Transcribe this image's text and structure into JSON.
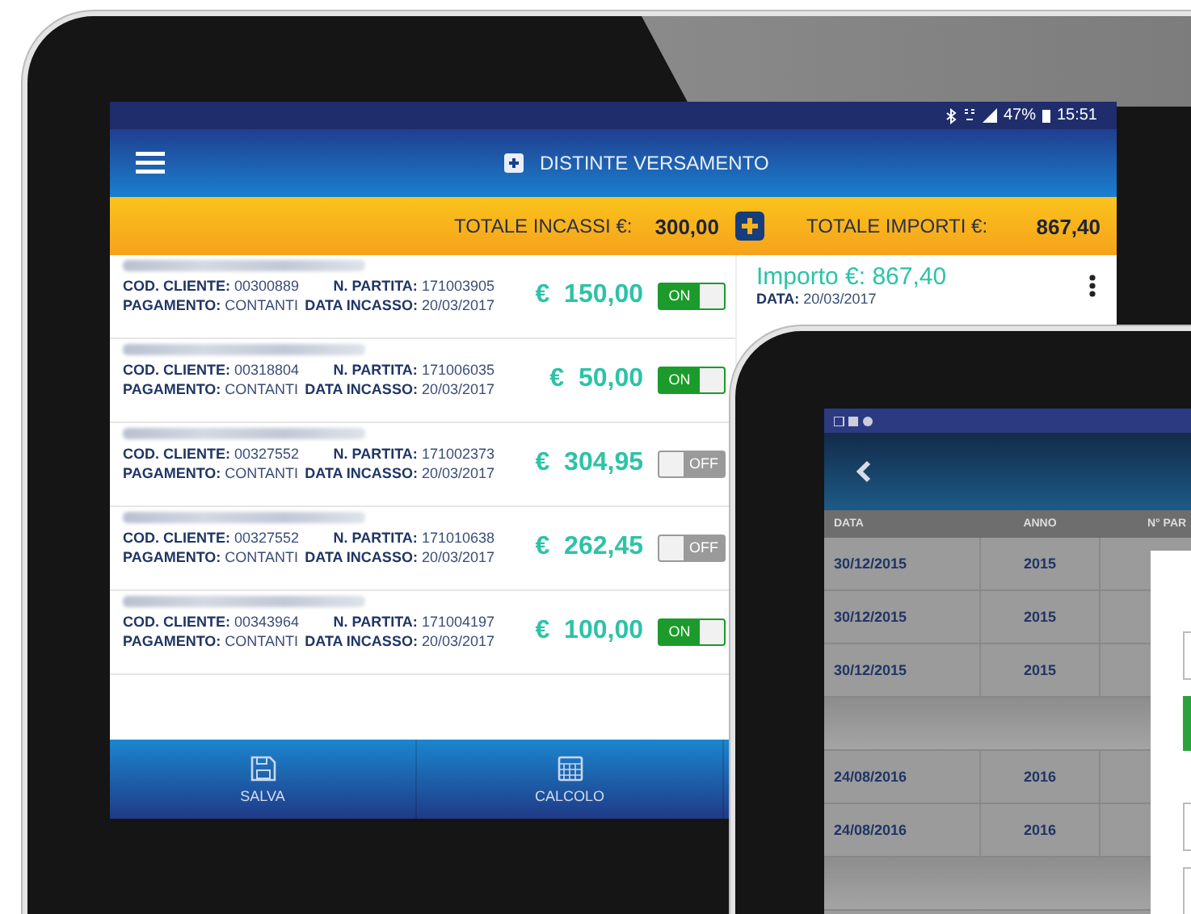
{
  "tablet_main": {
    "status_bar": {
      "battery": "47%",
      "time": "15:51"
    },
    "header": {
      "title": "DISTINTE VERSAMENTO"
    },
    "totals": {
      "incassi_label": "TOTALE INCASSI €:",
      "incassi_value": "300,00",
      "importi_label": "TOTALE IMPORTI €:",
      "importi_value": "867,40"
    },
    "payments": [
      {
        "cliente_label": "COD. CLIENTE:",
        "cliente": "00300889",
        "pagamento_label": "PAGAMENTO:",
        "pagamento": "CONTANTI",
        "partita_label": "N. PARTITA:",
        "partita": "171003905",
        "data_label": "DATA INCASSO:",
        "data": "20/03/2017",
        "amount": "€  150,00",
        "toggle": {
          "label": "ON",
          "on": true
        }
      },
      {
        "cliente_label": "COD. CLIENTE:",
        "cliente": "00318804",
        "pagamento_label": "PAGAMENTO:",
        "pagamento": "CONTANTI",
        "partita_label": "N. PARTITA:",
        "partita": "171006035",
        "data_label": "DATA INCASSO:",
        "data": "20/03/2017",
        "amount": "€  50,00",
        "toggle": {
          "label": "ON",
          "on": true
        }
      },
      {
        "cliente_label": "COD. CLIENTE:",
        "cliente": "00327552",
        "pagamento_label": "PAGAMENTO:",
        "pagamento": "CONTANTI",
        "partita_label": "N. PARTITA:",
        "partita": "171002373",
        "data_label": "DATA INCASSO:",
        "data": "20/03/2017",
        "amount": "€  304,95",
        "toggle": {
          "label": "OFF",
          "on": false
        }
      },
      {
        "cliente_label": "COD. CLIENTE:",
        "cliente": "00327552",
        "pagamento_label": "PAGAMENTO:",
        "pagamento": "CONTANTI",
        "partita_label": "N. PARTITA:",
        "partita": "171010638",
        "data_label": "DATA INCASSO:",
        "data": "20/03/2017",
        "amount": "€  262,45",
        "toggle": {
          "label": "OFF",
          "on": false
        }
      },
      {
        "cliente_label": "COD. CLIENTE:",
        "cliente": "00343964",
        "pagamento_label": "PAGAMENTO:",
        "pagamento": "CONTANTI",
        "partita_label": "N. PARTITA:",
        "partita": "171004197",
        "data_label": "DATA INCASSO:",
        "data": "20/03/2017",
        "amount": "€  100,00",
        "toggle": {
          "label": "ON",
          "on": true
        }
      }
    ],
    "detail": {
      "importo": "Importo €: 867,40",
      "data_label": "DATA:",
      "data": "20/03/2017"
    },
    "bottom_bar": [
      {
        "label": "SALVA",
        "kind": "save"
      },
      {
        "label": "CALCOLO",
        "kind": "calculator"
      }
    ]
  },
  "tablet_second": {
    "columns": [
      "DATA",
      "ANNO",
      "N° PAR"
    ],
    "rows": [
      {
        "kind": "data",
        "cells": [
          "30/12/2015",
          "2015"
        ]
      },
      {
        "kind": "data",
        "cells": [
          "30/12/2015",
          "2015"
        ]
      },
      {
        "kind": "data",
        "cells": [
          "30/12/2015",
          "2015"
        ]
      },
      {
        "kind": "empty"
      },
      {
        "kind": "data",
        "cells": [
          "24/08/2016",
          "2016"
        ]
      },
      {
        "kind": "data",
        "cells": [
          "24/08/2016",
          "2016"
        ]
      },
      {
        "kind": "empty"
      }
    ]
  }
}
